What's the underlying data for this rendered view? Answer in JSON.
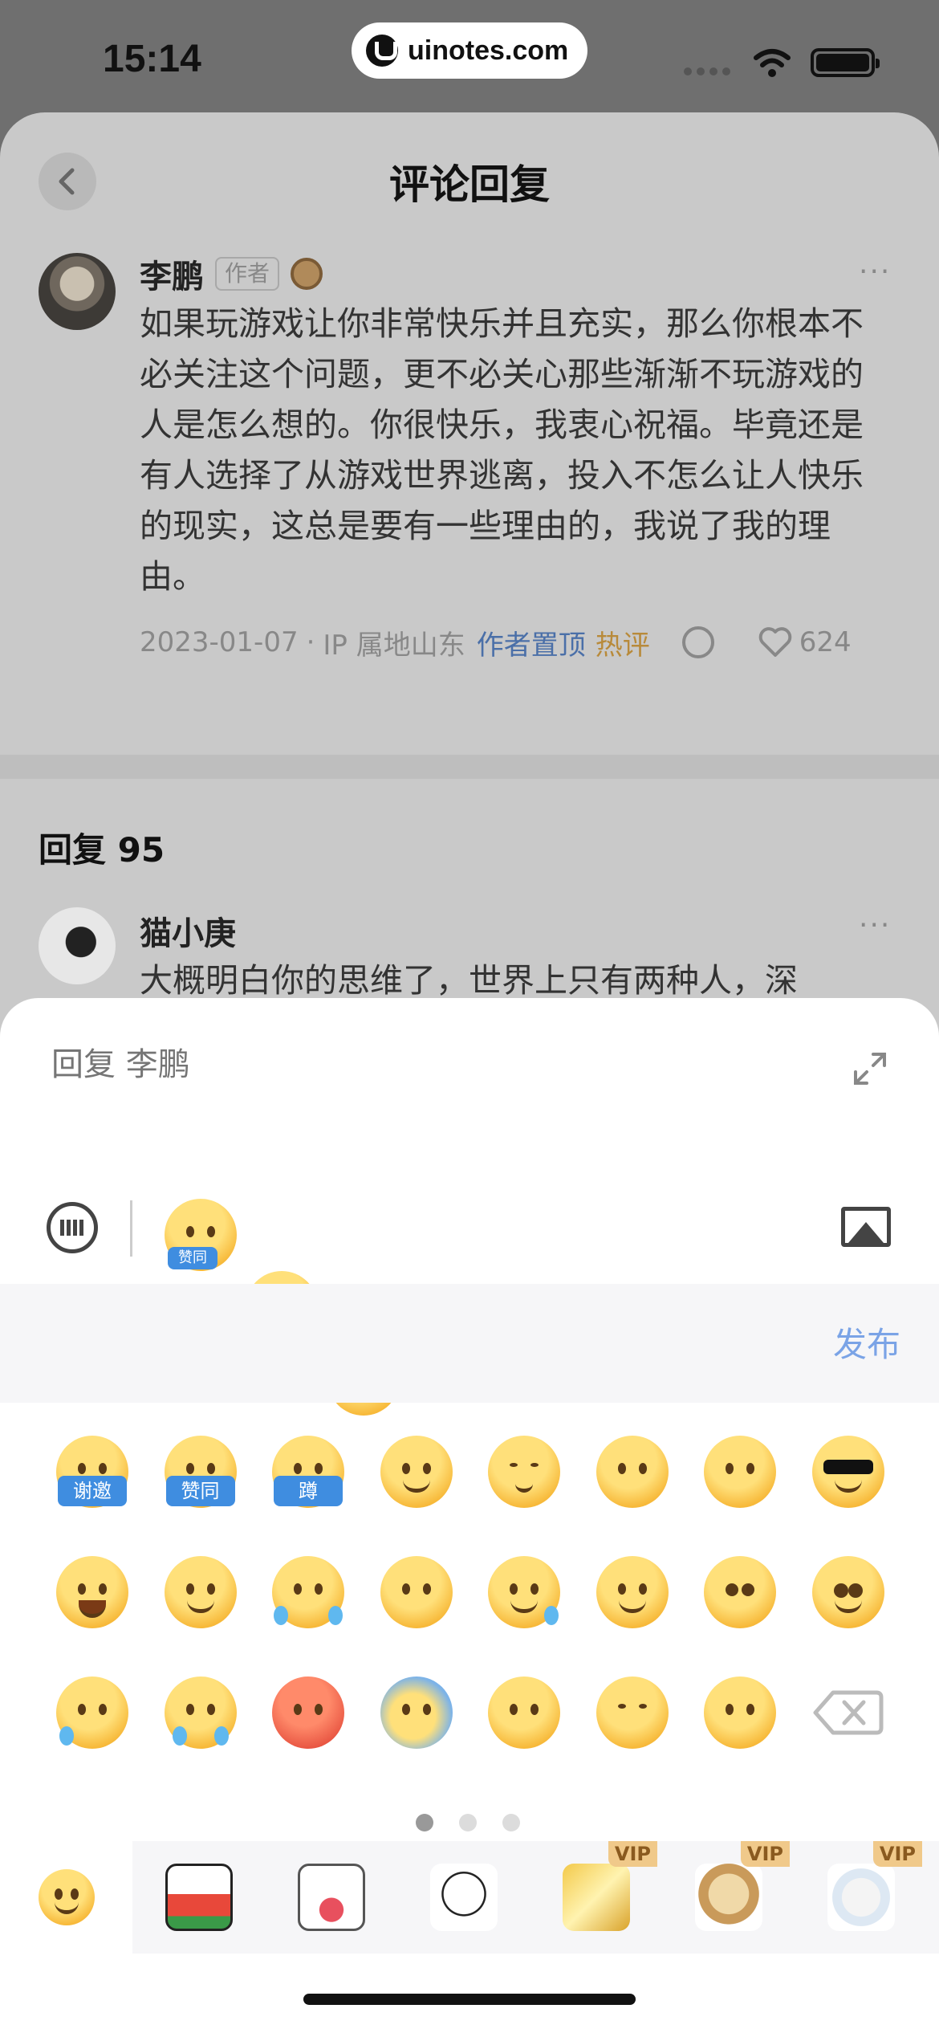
{
  "status_bar": {
    "time": "15:14",
    "url": "uinotes.com"
  },
  "header": {
    "title": "评论回复"
  },
  "comment": {
    "author": "李鹏",
    "author_tag": "作者",
    "text": "如果玩游戏让你非常快乐并且充实，那么你根本不必关注这个问题，更不必关心那些渐渐不玩游戏的人是怎么想的。你很快乐，我衷心祝福。毕竟还是有人选择了从游戏世界逃离，投入不怎么让人快乐的现实，这总是要有一些理由的，我说了我的理由。",
    "date": "2023-01-07",
    "sep": "·",
    "location": "IP 属地山东",
    "pinned": "作者置顶",
    "hot": "热评",
    "likes": "624",
    "more": "···"
  },
  "replies": {
    "label": "回复 95",
    "first": {
      "user": "猫小庚",
      "text": "大概明白你的思维了，世界上只有两种人，深"
    }
  },
  "reply_panel": {
    "placeholder": "回复 李鹏",
    "publish": "发布",
    "quick_labels": [
      "赞同"
    ],
    "emoji_labels": [
      "谢邀",
      "赞同",
      "蹲"
    ],
    "page_dots": 3,
    "active_page": 0
  },
  "sticker_tabs": [
    {
      "icon": "smile-emoji-icon",
      "vip": ""
    },
    {
      "icon": "watermelon-cow-sticker-icon",
      "vip": ""
    },
    {
      "icon": "cat-heart-sticker-icon",
      "vip": ""
    },
    {
      "icon": "ghost-bowtie-sticker-icon",
      "vip": ""
    },
    {
      "icon": "gold-sparkle-sticker-icon",
      "vip": "VIP"
    },
    {
      "icon": "shiba-phone-sticker-icon",
      "vip": "VIP"
    },
    {
      "icon": "white-bear-sticker-icon",
      "vip": "VIP"
    }
  ],
  "colors": {
    "accent_blue": "#4a6fa8",
    "publish": "#7aa3e6",
    "hot": "#b88a3a",
    "vip": "#f0c98a"
  }
}
